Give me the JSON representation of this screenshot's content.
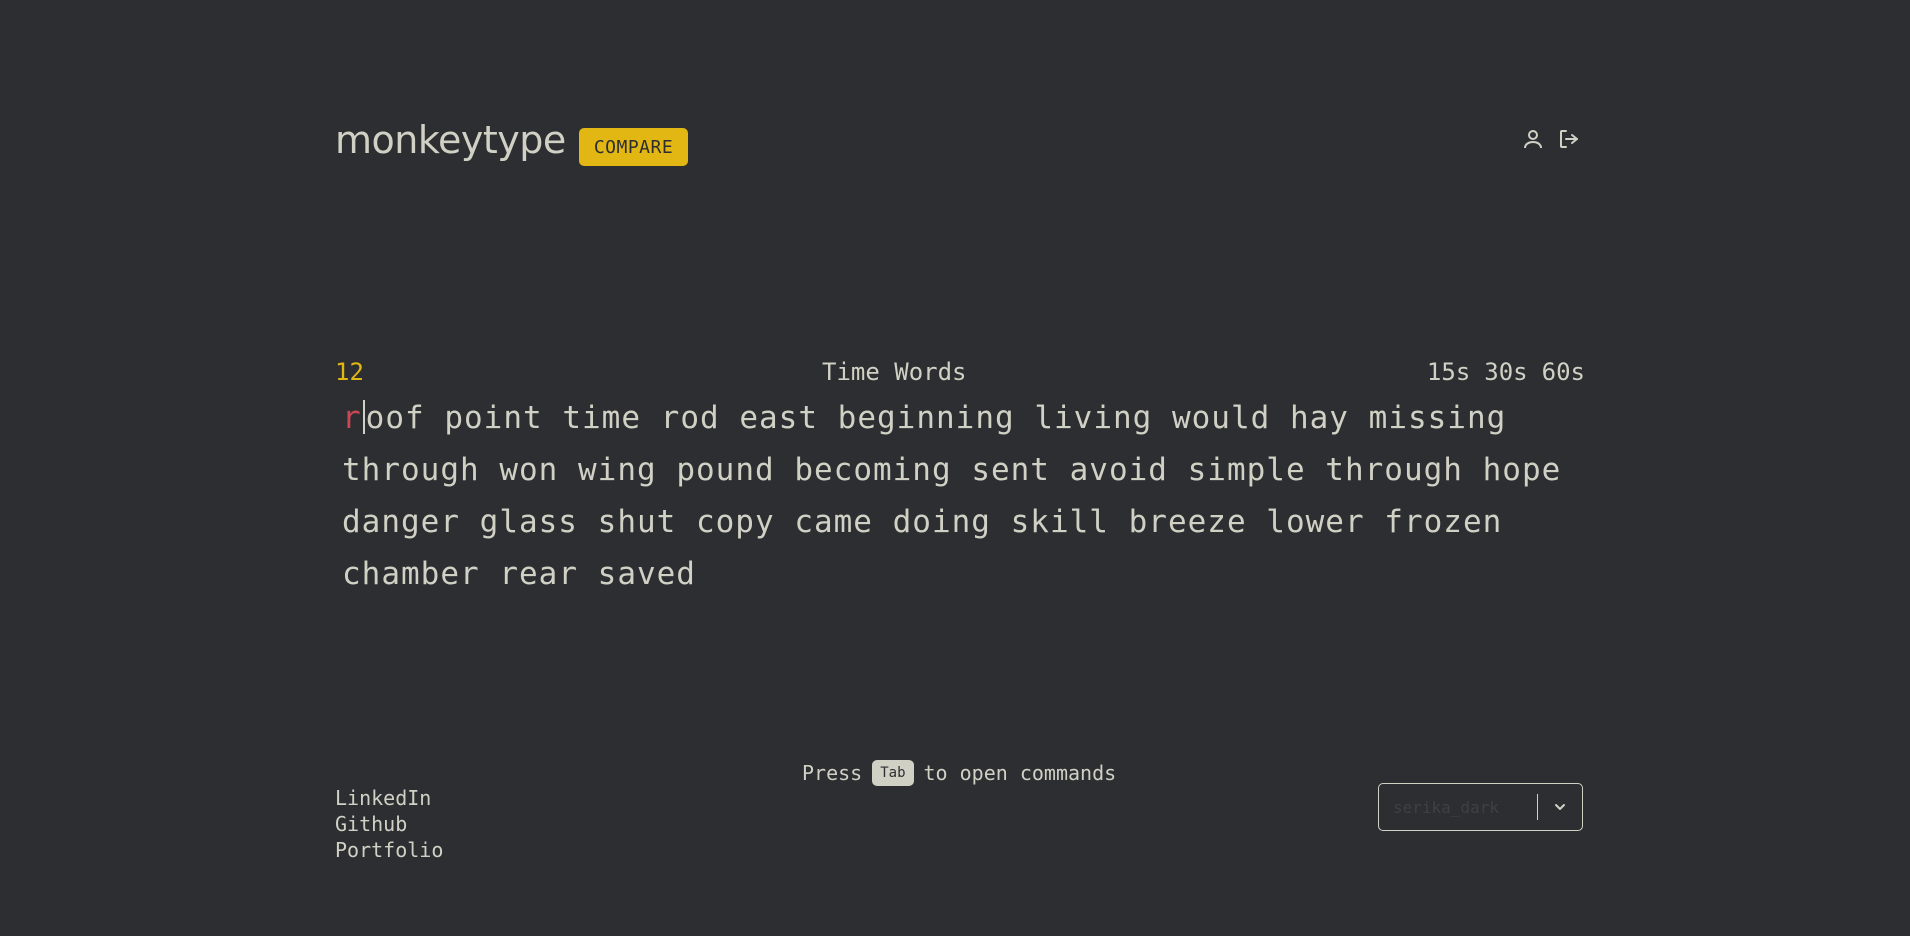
{
  "header": {
    "logo": "monkeytype",
    "compare_label": "COMPARE",
    "icons": [
      "user-icon",
      "sign-out-icon"
    ]
  },
  "test": {
    "timer": "12",
    "mode_title": "Time Words",
    "time_options": [
      "15s",
      "30s",
      "60s"
    ],
    "current_word_typed": "r",
    "current_word_rest": "oof",
    "words": [
      "point",
      "time",
      "rod",
      "east",
      "beginning",
      "living",
      "would",
      "hay",
      "missing",
      "through",
      "won",
      "wing",
      "pound",
      "becoming",
      "sent",
      "avoid",
      "simple",
      "through",
      "hope",
      "danger",
      "glass",
      "shut",
      "copy",
      "came",
      "doing",
      "skill",
      "breeze",
      "lower",
      "frozen",
      "chamber",
      "rear",
      "saved"
    ]
  },
  "footer": {
    "hint_prefix": "Press",
    "hint_key": "Tab",
    "hint_suffix": "to open commands",
    "links": [
      "LinkedIn",
      "Github",
      "Portfolio"
    ],
    "select_value": "serika_dark"
  },
  "colors": {
    "background": "#2c2e31",
    "text": "#d1d0c5",
    "accent": "#e2b714",
    "error": "#ca4754"
  }
}
